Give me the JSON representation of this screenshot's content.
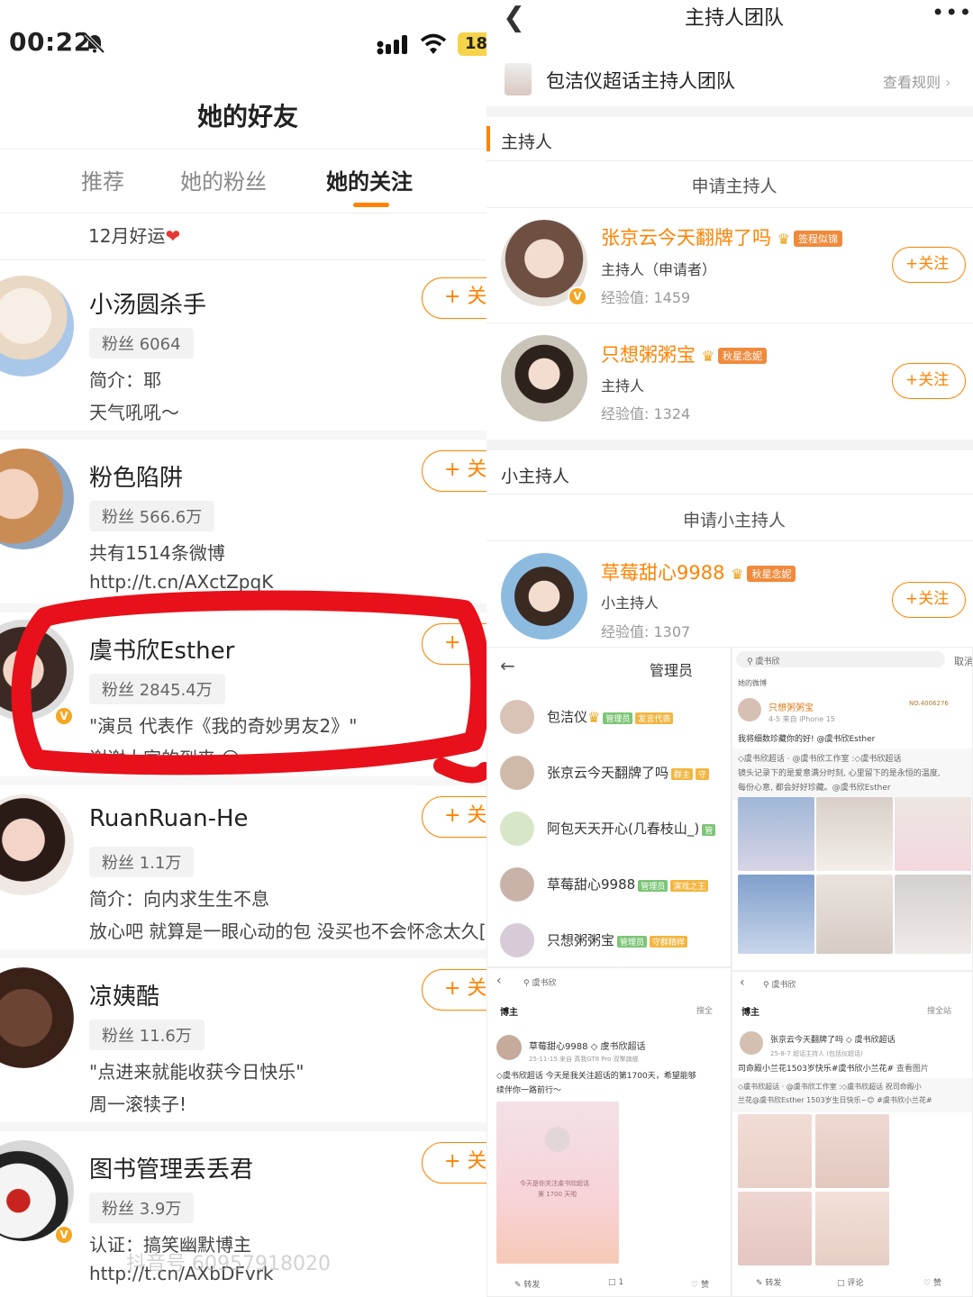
{
  "left": {
    "status": {
      "time": "00:22",
      "battery": "18"
    },
    "title": "她的好友",
    "tabs": [
      "推荐",
      "她的粉丝",
      "她的关注"
    ],
    "motto": "12月好运",
    "follow_label": "+ 关",
    "users": [
      {
        "name": "小汤圆杀手",
        "fans": "粉丝 6064",
        "line1": "简介：耶",
        "line2": "天气吼吼～"
      },
      {
        "name": "粉色陷阱",
        "fans": "粉丝 566.6万",
        "line1": "共有1514条微博",
        "line2": "http://t.cn/AXctZpqK"
      },
      {
        "name": "虞书欣Esther",
        "fans": "粉丝 2845.4万",
        "line1": "\"演员 代表作《我的奇妙男友2》\"",
        "line2": "谢谢大家的到来 😛"
      },
      {
        "name": "RuanRuan-He",
        "fans": "粉丝 1.1万",
        "line1": "简介：向内求生生不息",
        "line2": "放心吧 就算是一眼心动的包 没买也不会怀念太久["
      },
      {
        "name": "凉姨酷",
        "fans": "粉丝 11.6万",
        "line1": "\"点进来就能收获今日快乐\"",
        "line2": "周一滚犊子!"
      },
      {
        "name": "图书管理丢丢君",
        "fans": "粉丝 3.9万",
        "line1": "认证：搞笑幽默博主",
        "line2": "http://t.cn/AXbDFvrk"
      }
    ],
    "watermark": "抖音号 60957918020"
  },
  "right": {
    "title": "主持人团队",
    "team": "包洁仪超话主持人团队",
    "rules": "查看规则",
    "section_host": "主持人",
    "apply_host": "申请主持人",
    "section_small": "小主持人",
    "apply_small": "申请小主持人",
    "follow_label": "+关注",
    "hosts": [
      {
        "name": "张京云今天翻牌了吗",
        "tag": "签程似锦",
        "role": "主持人（申请者）",
        "exp": "经验值: 1459"
      },
      {
        "name": "只想粥粥宝",
        "tag": "秋星念妮",
        "role": "主持人",
        "exp": "经验值: 1324"
      },
      {
        "name": "草莓甜心9988",
        "tag": "秋星念妮",
        "role": "小主持人",
        "exp": "经验值: 1307"
      }
    ],
    "admin": {
      "title": "管理员",
      "rows": [
        {
          "name": "包洁仪",
          "tag1": "管理员",
          "tag2": "发言代表"
        },
        {
          "name": "张京云今天翻牌了吗",
          "tag1": "群主",
          "tag2": "守"
        },
        {
          "name": "阿包天天开心(几春枝山_)",
          "tag1": "管",
          "tag2": ""
        },
        {
          "name": "草莓甜心9988",
          "tag1": "管理员",
          "tag2": "演戏之王"
        },
        {
          "name": "只想粥粥宝",
          "tag1": "管理员",
          "tag2": "守群精样"
        }
      ]
    },
    "search1": {
      "query": "虞书欣",
      "cancel": "取消",
      "section": "她的微博",
      "user": "只想粥粥宝",
      "meta": "4-5 来自 iPhone 15",
      "no": "NO.4006276",
      "text1": "我将细数珍藏你的好! @虞书欣Esther",
      "text2": "◇虞书欣超话 · @虞书欣工作室 :◇虞书欣超话",
      "text3": "镜头记录下的是爱意满分时刻, 心里留下的是永恒的温度,",
      "text4": "每份心意, 都会好好珍藏。@虞书欣Esther"
    },
    "search2": {
      "query": "虞书欣",
      "tab": "博主",
      "search_all": "搜全",
      "user": "草莓甜心9988",
      "topic": "虞书欣超话",
      "meta": "25-11-15 来自 真我GT8 Pro 双擎旗舰",
      "text1": "◇虞书欣超话 今天是我关注超话的第1700天，希望能够",
      "text2": "续伴你一路前行～",
      "card1": "今天是你关注虞书欣超话",
      "card2": "第 1700 天啦",
      "repost": "转发",
      "comment": "1",
      "like": "赞"
    },
    "search3": {
      "query": "虞书欣",
      "tab": "博主",
      "search_all": "搜全站",
      "user": "张京云今天翻牌了吗",
      "topic": "虞书欣超话",
      "meta": "25-8-7 超话主持人 (包括仪超话)",
      "text1": "司命殿小兰花1503岁快乐#虞书欣小兰花#",
      "view_pic": "查看图片",
      "text2": "◇虞书欣超话 · @虞书欣工作室 :◇虞书欣超话 祝司命殿小",
      "text3": "兰花@虞书欣Esther 1503岁生日快乐~😊 #虞书欣小兰花#",
      "repost": "转发",
      "comment": "评论",
      "like": "赞"
    }
  }
}
